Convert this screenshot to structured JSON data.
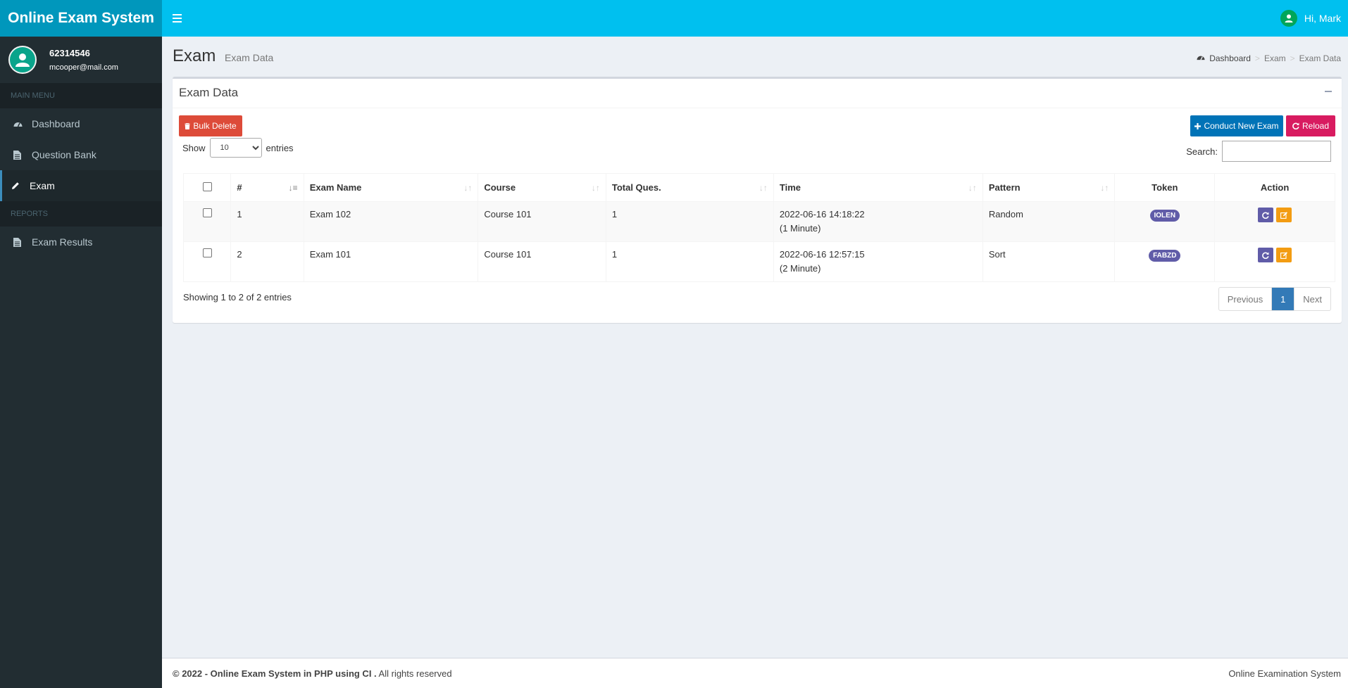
{
  "app": {
    "logo": "Online Exam System"
  },
  "navbar": {
    "greeting": "Hi, Mark"
  },
  "user": {
    "id": "62314546",
    "email": "mcooper@mail.com"
  },
  "sidebar": {
    "header_main": "MAIN MENU",
    "items": [
      {
        "label": "Dashboard",
        "icon": "dashboard-icon"
      },
      {
        "label": "Question Bank",
        "icon": "file-icon"
      },
      {
        "label": "Exam",
        "icon": "pencil-icon",
        "active": true
      }
    ],
    "header_reports": "REPORTS",
    "report_items": [
      {
        "label": "Exam Results",
        "icon": "file-icon"
      }
    ]
  },
  "page": {
    "title": "Exam",
    "subtitle": "Exam Data"
  },
  "breadcrumb": {
    "home": "Dashboard",
    "level1": "Exam",
    "level2": "Exam Data"
  },
  "box": {
    "title": "Exam Data"
  },
  "buttons": {
    "bulk_delete": "Bulk Delete",
    "conduct": "Conduct New Exam",
    "reload": "Reload"
  },
  "table_controls": {
    "show": "Show",
    "length_value": "10",
    "entries": "entries",
    "search_label": "Search:"
  },
  "columns": [
    "#",
    "Exam Name",
    "Course",
    "Total Ques.",
    "Time",
    "Pattern",
    "Token",
    "Action"
  ],
  "rows": [
    {
      "no": "1",
      "name": "Exam 102",
      "course": "Course 101",
      "total": "1",
      "time": "2022-06-16 14:18:22",
      "duration": "(1 Minute)",
      "pattern": "Random",
      "token": "IOLEN"
    },
    {
      "no": "2",
      "name": "Exam 101",
      "course": "Course 101",
      "total": "1",
      "time": "2022-06-16 12:57:15",
      "duration": "(2 Minute)",
      "pattern": "Sort",
      "token": "FABZD"
    }
  ],
  "pagination": {
    "info": "Showing 1 to 2 of 2 entries",
    "previous": "Previous",
    "current": "1",
    "next": "Next"
  },
  "footer": {
    "copyright": "© 2022 - Online Exam System in PHP using CI .",
    "rights": " All rights reserved",
    "right": "Online Examination System"
  },
  "colors": {
    "navbar": "#00c0ef",
    "logo": "#0097bc",
    "sidebar": "#222d32",
    "danger": "#dd4b39",
    "primary": "#0073b7",
    "pink": "#d81b60",
    "purple": "#605ca8",
    "orange": "#f39c12"
  }
}
